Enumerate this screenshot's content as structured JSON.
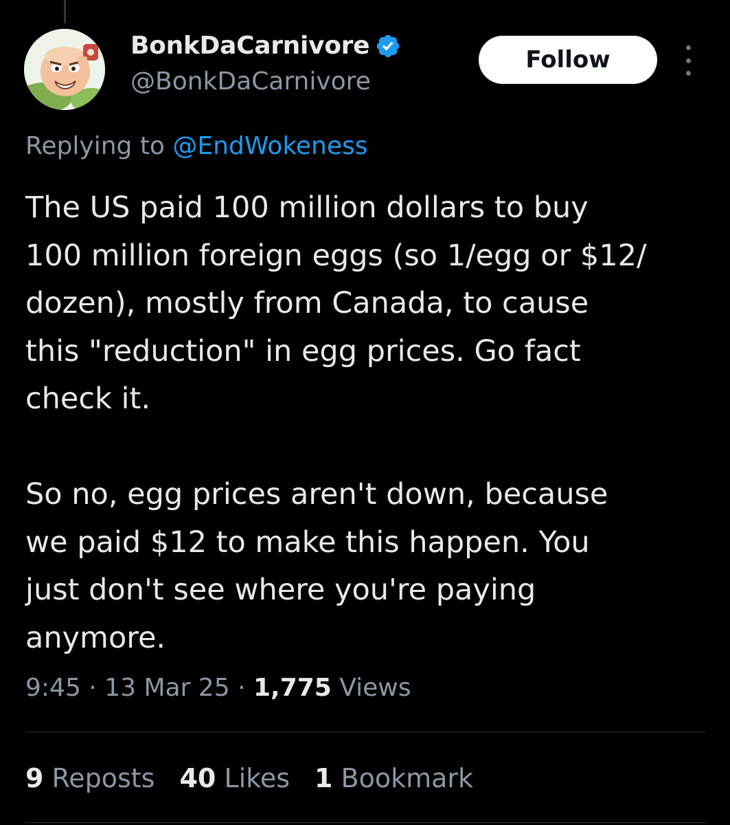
{
  "author": {
    "display_name": "BonkDaCarnivore",
    "handle": "@BonkDaCarnivore",
    "verified": true
  },
  "follow_label": "Follow",
  "reply_context": {
    "prefix": "Replying to ",
    "mention": "@EndWokeness"
  },
  "tweet": {
    "paragraph_1": "The US paid 100 million dollars to buy\n100 million foreign eggs (so 1/egg or $12/\ndozen), mostly from Canada, to cause\nthis \"reduction\" in egg prices.  Go fact\ncheck it.",
    "paragraph_2": "So no, egg prices aren't down, because\nwe paid $12 to make this happen.  You\njust don't see where you're paying\nanymore."
  },
  "meta": {
    "time": "9:45",
    "separator": " · ",
    "date": "13 Mar 25",
    "views_count": "1,775",
    "views_label": " Views"
  },
  "stats": {
    "reposts_count": "9",
    "reposts_label": " Reposts",
    "likes_count": "40",
    "likes_label": " Likes",
    "bookmarks_count": "1",
    "bookmarks_label": " Bookmark"
  },
  "colors": {
    "background": "#000000",
    "text": "#e7e9ea",
    "secondary_text": "#8b98a5",
    "link": "#1d9bf0",
    "verified_badge": "#1d9bf0",
    "follow_button_bg": "#ffffff"
  },
  "icons": {
    "verified": "verified-badge-icon",
    "more": "more-options-icon"
  }
}
